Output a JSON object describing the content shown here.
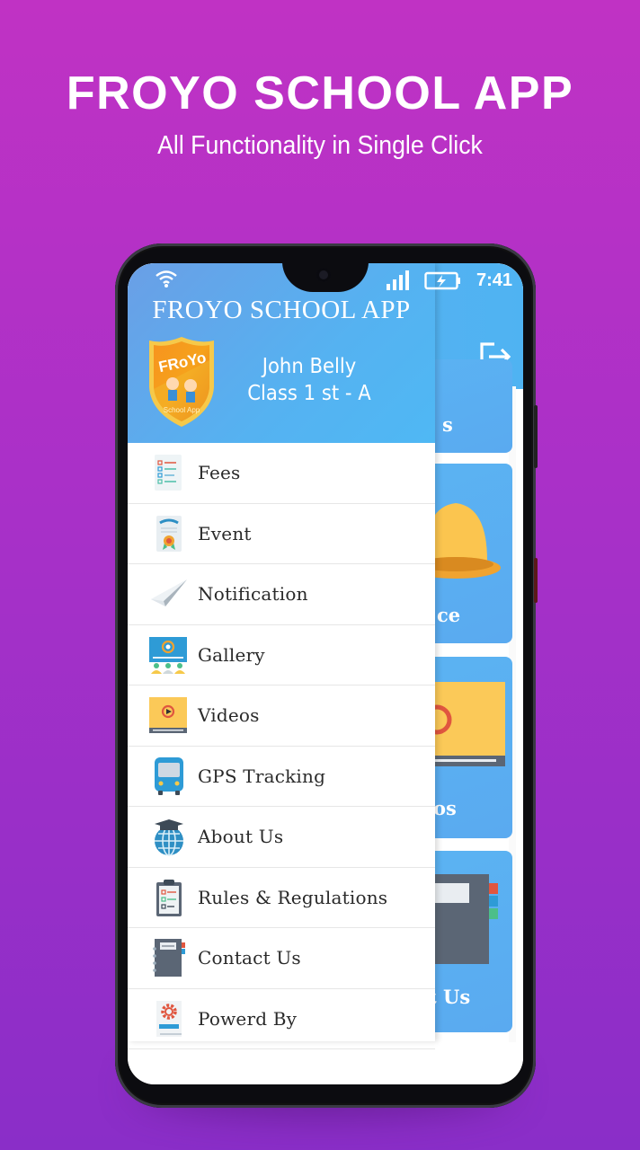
{
  "promo": {
    "title": "FROYO SCHOOL APP",
    "subtitle": "All Functionality in Single Click"
  },
  "status_bar": {
    "wifi_icon": "wifi-icon",
    "signal_icon": "signal-icon",
    "battery_icon": "battery-charging-icon",
    "time": "7:41"
  },
  "drawer": {
    "title": "FROYO SCHOOL APP",
    "logo": {
      "brand": "FRoYo",
      "caption": "School App"
    },
    "user": {
      "name": "John Belly",
      "class": "Class 1 st - A"
    },
    "items": [
      {
        "label": "Fees",
        "icon": "checklist-document-icon"
      },
      {
        "label": "Event",
        "icon": "certificate-icon"
      },
      {
        "label": "Notification",
        "icon": "paper-plane-icon"
      },
      {
        "label": "Gallery",
        "icon": "presentation-screen-icon"
      },
      {
        "label": "Videos",
        "icon": "video-player-icon"
      },
      {
        "label": "GPS Tracking",
        "icon": "bus-icon"
      },
      {
        "label": "About Us",
        "icon": "graduation-globe-icon"
      },
      {
        "label": "Rules & Regulations",
        "icon": "clipboard-icon"
      },
      {
        "label": "Contact Us",
        "icon": "notebook-icon"
      },
      {
        "label": "Powerd By",
        "icon": "gear-document-icon"
      }
    ]
  },
  "background_app": {
    "logout_icon": "logout-icon",
    "tiles": [
      {
        "partial_label": "s"
      },
      {
        "partial_label": "ce"
      },
      {
        "partial_label": "os"
      },
      {
        "partial_label": "t Us"
      }
    ]
  },
  "colors": {
    "header_blue": "#55b2f1",
    "tile_blue": "#5aaaf0",
    "background_purple": "#a830c8",
    "text_dark": "#2a2a2a"
  }
}
